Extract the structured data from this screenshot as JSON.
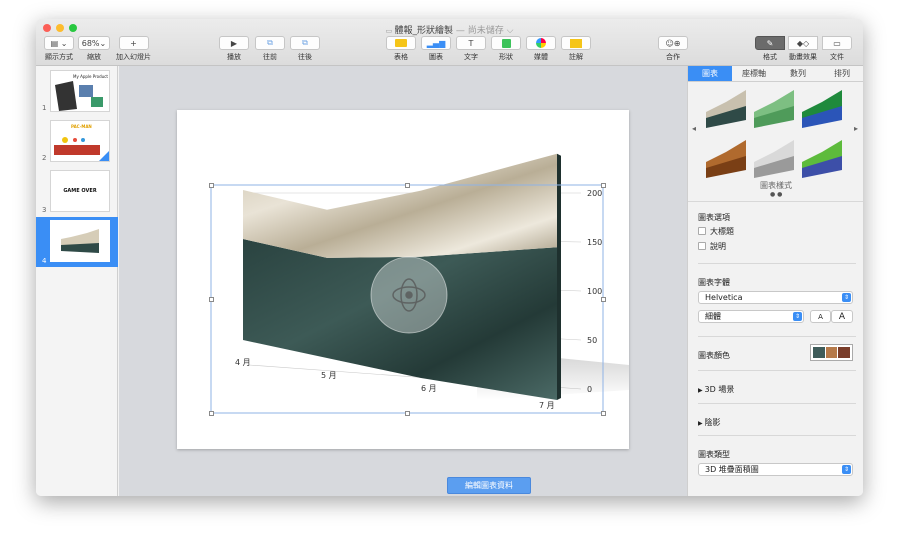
{
  "window": {
    "title": "體報_形狀繪製",
    "title_suffix": "— 尚未儲存 ⌵"
  },
  "toolbar": {
    "view_label": "顯示方式",
    "zoom_value": "68%",
    "zoom_label": "縮放",
    "add_slide_label": "加入幻燈片",
    "play_label": "播放",
    "front_label": "往前",
    "back_label": "往後",
    "table_label": "表格",
    "chart_label": "圖表",
    "text_label": "文字",
    "shape_label": "形狀",
    "media_label": "媒體",
    "comment_label": "註解",
    "collab_label": "合作",
    "format_label": "格式",
    "animate_label": "動畫效果",
    "document_label": "文件"
  },
  "slides": [
    {
      "num": "1",
      "title": "My Apple Product"
    },
    {
      "num": "2",
      "title": "PAC-MAN"
    },
    {
      "num": "3",
      "title": "GAME OVER"
    },
    {
      "num": "4",
      "title": ""
    }
  ],
  "chart_data": {
    "type": "area",
    "categories": [
      "4 月",
      "5 月",
      "6 月",
      "7 月"
    ],
    "values": [
      100,
      90,
      130,
      190
    ],
    "ylim": [
      0,
      200
    ],
    "yticks": [
      "0",
      "50",
      "100",
      "150",
      "200"
    ],
    "title": "",
    "xlabel": "",
    "ylabel": ""
  },
  "canvas": {
    "edit_data_label": "編輯圖表資料"
  },
  "inspector": {
    "tabs": [
      "圖表",
      "座標軸",
      "數列",
      "排列"
    ],
    "styles_label": "圖表樣式",
    "chart_options_label": "圖表選項",
    "title_option": "大標題",
    "caption_option": "說明",
    "font_label": "圖表字體",
    "font_value": "Helvetica",
    "weight_value": "細體",
    "font_small": "A",
    "font_large": "A",
    "color_label": "圖表顏色",
    "scene_label": "3D 場景",
    "shadow_label": "陰影",
    "type_label": "圖表類型",
    "type_value": "3D 堆疊面積圖"
  },
  "colors": {
    "accent": "#3a8ef5",
    "marble_light": "#d9d2c2",
    "marble_dark": "#2f4a47"
  }
}
